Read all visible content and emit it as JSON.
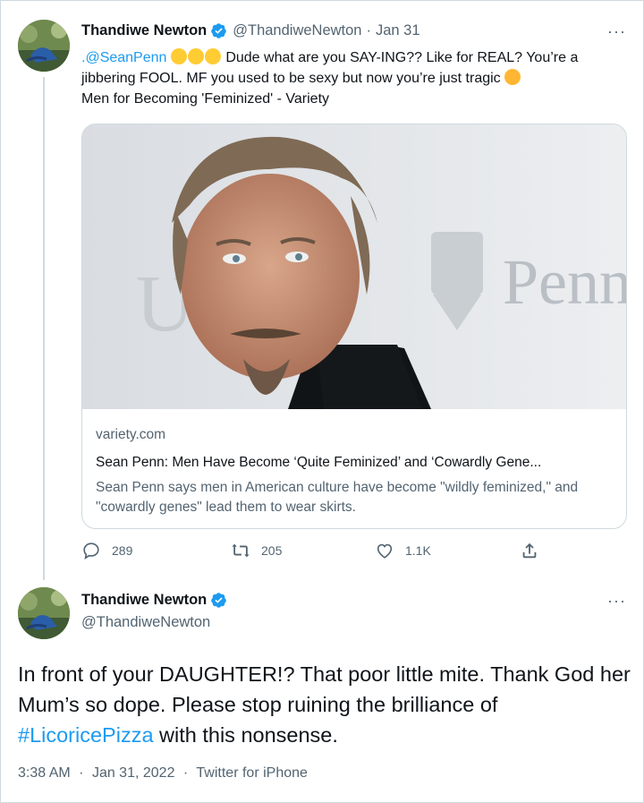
{
  "tweet1": {
    "author_name": "Thandiwe Newton",
    "handle": "@ThandiweNewton",
    "separator": "·",
    "date": "Jan 31",
    "more_label": "···",
    "mention": ".@SeanPenn",
    "text_a": " Dude what are you SAY-ING?? Like for REAL? You’re a jibbering FOOL. MF you used to be sexy but now you’re just tragic ",
    "text_b": "Men for Becoming 'Feminized' - Variety",
    "card": {
      "image_text": "Penn",
      "domain": "variety.com",
      "title": "Sean Penn: Men Have Become ‘Quite Feminized’ and ‘Cowardly Gene...",
      "description": "Sean Penn says men in American culture have become \"wildly feminized,\" and \"cowardly genes\" lead them to wear skirts."
    },
    "actions": {
      "replies": "289",
      "retweets": "205",
      "likes": "1.1K"
    }
  },
  "tweet2": {
    "author_name": "Thandiwe Newton",
    "handle": "@ThandiweNewton",
    "more_label": "···",
    "text_a": "In front of your DAUGHTER!? That poor little mite. Thank God her Mum’s so dope. Please stop ruining the brilliance of ",
    "hashtag": "#LicoricePizza",
    "text_b": " with this nonsense.",
    "time": "3:38 AM",
    "separator": "·",
    "date": "Jan 31, 2022",
    "source": "Twitter for iPhone"
  },
  "colors": {
    "link": "#1d9bf0",
    "secondary_text": "#536471",
    "border": "#cfd9de",
    "verified": "#1d9bf0"
  }
}
